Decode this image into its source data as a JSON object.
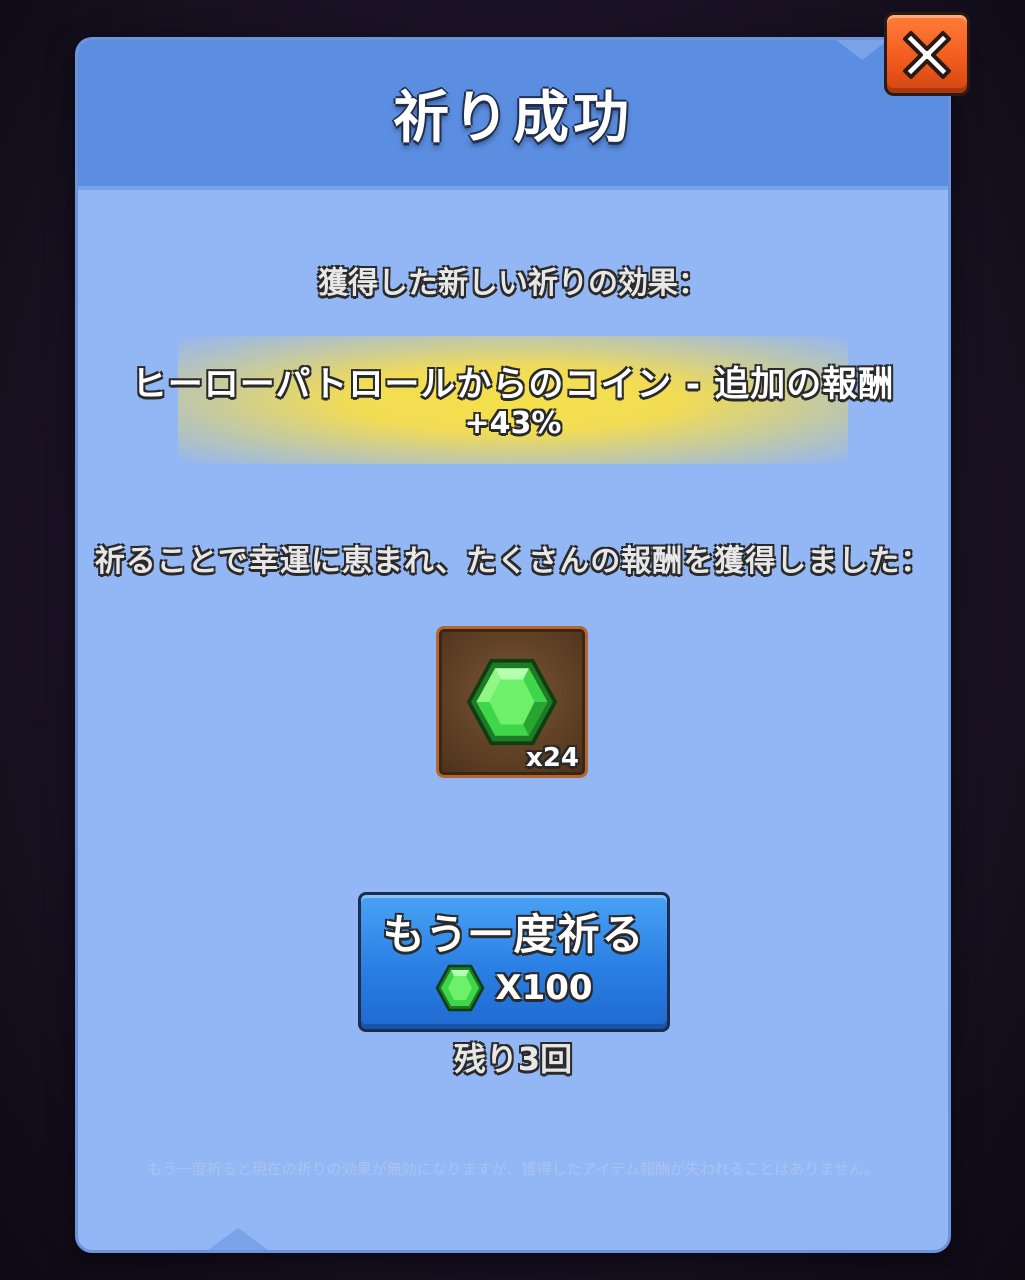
{
  "dialog": {
    "title": "祈り成功",
    "effect_heading": "獲得した新しい祈りの効果：",
    "effect_name": "ヒーローパトロールからのコイン - 追加の報酬",
    "effect_value": "+43%",
    "reward_heading": "祈ることで幸運に恵まれ、たくさんの報酬を獲得しました：",
    "reward": {
      "icon": "green-gem-icon",
      "count_label": "x24"
    },
    "pray_again_button": {
      "label": "もう一度祈る",
      "cost_icon": "green-gem-icon",
      "cost_label": "X100"
    },
    "remaining_label": "残り3回",
    "footnote": "もう一度祈ると現在の祈りの効果が無効になりますが、獲得したアイテム報酬が失われることはありません。",
    "close_icon": "close-x-icon"
  },
  "colors": {
    "panel": "#93b6f4",
    "header": "#5b8de0",
    "highlight": "#f5e04a",
    "button": "#2a7fe3",
    "close_button": "#f05a1c",
    "gem": "#3ed64a"
  }
}
